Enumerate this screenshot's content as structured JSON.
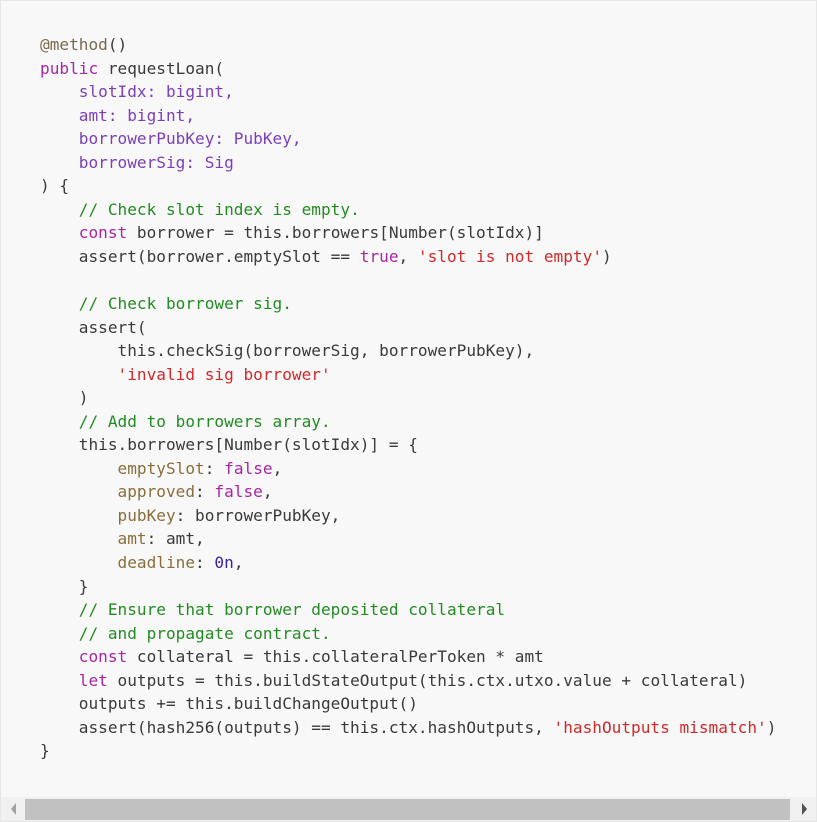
{
  "code_block": {
    "language": "typescript",
    "lines": [
      [
        {
          "t": "dec",
          "v": "@method"
        },
        {
          "t": "plain",
          "v": "()"
        }
      ],
      [
        {
          "t": "kw",
          "v": "public"
        },
        {
          "t": "plain",
          "v": " requestLoan("
        }
      ],
      [
        {
          "t": "plain",
          "v": "    "
        },
        {
          "t": "param",
          "v": "slotIdx: bigint,"
        }
      ],
      [
        {
          "t": "plain",
          "v": "    "
        },
        {
          "t": "param",
          "v": "amt: bigint,"
        }
      ],
      [
        {
          "t": "plain",
          "v": "    "
        },
        {
          "t": "param",
          "v": "borrowerPubKey: PubKey,"
        }
      ],
      [
        {
          "t": "plain",
          "v": "    "
        },
        {
          "t": "param",
          "v": "borrowerSig: Sig"
        }
      ],
      [
        {
          "t": "plain",
          "v": ") {"
        }
      ],
      [
        {
          "t": "plain",
          "v": "    "
        },
        {
          "t": "cm",
          "v": "// Check slot index is empty."
        }
      ],
      [
        {
          "t": "plain",
          "v": "    "
        },
        {
          "t": "kw",
          "v": "const"
        },
        {
          "t": "plain",
          "v": " borrower = this.borrowers[Number(slotIdx)]"
        }
      ],
      [
        {
          "t": "plain",
          "v": "    assert(borrower.emptySlot == "
        },
        {
          "t": "bool",
          "v": "true"
        },
        {
          "t": "plain",
          "v": ", "
        },
        {
          "t": "str",
          "v": "'slot is not empty'"
        },
        {
          "t": "plain",
          "v": ")"
        }
      ],
      [
        {
          "t": "plain",
          "v": ""
        }
      ],
      [
        {
          "t": "plain",
          "v": "    "
        },
        {
          "t": "cm",
          "v": "// Check borrower sig."
        }
      ],
      [
        {
          "t": "plain",
          "v": "    assert("
        }
      ],
      [
        {
          "t": "plain",
          "v": "        this.checkSig(borrowerSig, borrowerPubKey),"
        }
      ],
      [
        {
          "t": "plain",
          "v": "        "
        },
        {
          "t": "str",
          "v": "'invalid sig borrower'"
        }
      ],
      [
        {
          "t": "plain",
          "v": "    )"
        }
      ],
      [
        {
          "t": "plain",
          "v": "    "
        },
        {
          "t": "cm",
          "v": "// Add to borrowers array."
        }
      ],
      [
        {
          "t": "plain",
          "v": "    this.borrowers[Number(slotIdx)] = {"
        }
      ],
      [
        {
          "t": "plain",
          "v": "        "
        },
        {
          "t": "prop",
          "v": "emptySlot"
        },
        {
          "t": "plain",
          "v": ": "
        },
        {
          "t": "bool",
          "v": "false"
        },
        {
          "t": "plain",
          "v": ","
        }
      ],
      [
        {
          "t": "plain",
          "v": "        "
        },
        {
          "t": "prop",
          "v": "approved"
        },
        {
          "t": "plain",
          "v": ": "
        },
        {
          "t": "bool",
          "v": "false"
        },
        {
          "t": "plain",
          "v": ","
        }
      ],
      [
        {
          "t": "plain",
          "v": "        "
        },
        {
          "t": "prop",
          "v": "pubKey"
        },
        {
          "t": "plain",
          "v": ": borrowerPubKey,"
        }
      ],
      [
        {
          "t": "plain",
          "v": "        "
        },
        {
          "t": "prop",
          "v": "amt"
        },
        {
          "t": "plain",
          "v": ": amt,"
        }
      ],
      [
        {
          "t": "plain",
          "v": "        "
        },
        {
          "t": "prop",
          "v": "deadline"
        },
        {
          "t": "plain",
          "v": ": "
        },
        {
          "t": "num",
          "v": "0n"
        },
        {
          "t": "plain",
          "v": ","
        }
      ],
      [
        {
          "t": "plain",
          "v": "    }"
        }
      ],
      [
        {
          "t": "plain",
          "v": "    "
        },
        {
          "t": "cm",
          "v": "// Ensure that borrower deposited collateral"
        }
      ],
      [
        {
          "t": "plain",
          "v": "    "
        },
        {
          "t": "cm",
          "v": "// and propagate contract."
        }
      ],
      [
        {
          "t": "plain",
          "v": "    "
        },
        {
          "t": "kw",
          "v": "const"
        },
        {
          "t": "plain",
          "v": " collateral = this.collateralPerToken * amt"
        }
      ],
      [
        {
          "t": "plain",
          "v": "    "
        },
        {
          "t": "kw",
          "v": "let"
        },
        {
          "t": "plain",
          "v": " outputs = this.buildStateOutput(this.ctx.utxo.value + collateral)"
        }
      ],
      [
        {
          "t": "plain",
          "v": "    outputs += this.buildChangeOutput()"
        }
      ],
      [
        {
          "t": "plain",
          "v": "    assert(hash256(outputs) == this.ctx.hashOutputs, "
        },
        {
          "t": "str",
          "v": "'hashOutputs mismatch'"
        },
        {
          "t": "plain",
          "v": ")"
        }
      ],
      [
        {
          "t": "plain",
          "v": "}"
        }
      ]
    ]
  },
  "scrollbar": {
    "left_icon": "triangle-left-icon",
    "right_icon": "triangle-right-icon",
    "thumb_fraction": 0.97,
    "scroll_position": 0
  }
}
